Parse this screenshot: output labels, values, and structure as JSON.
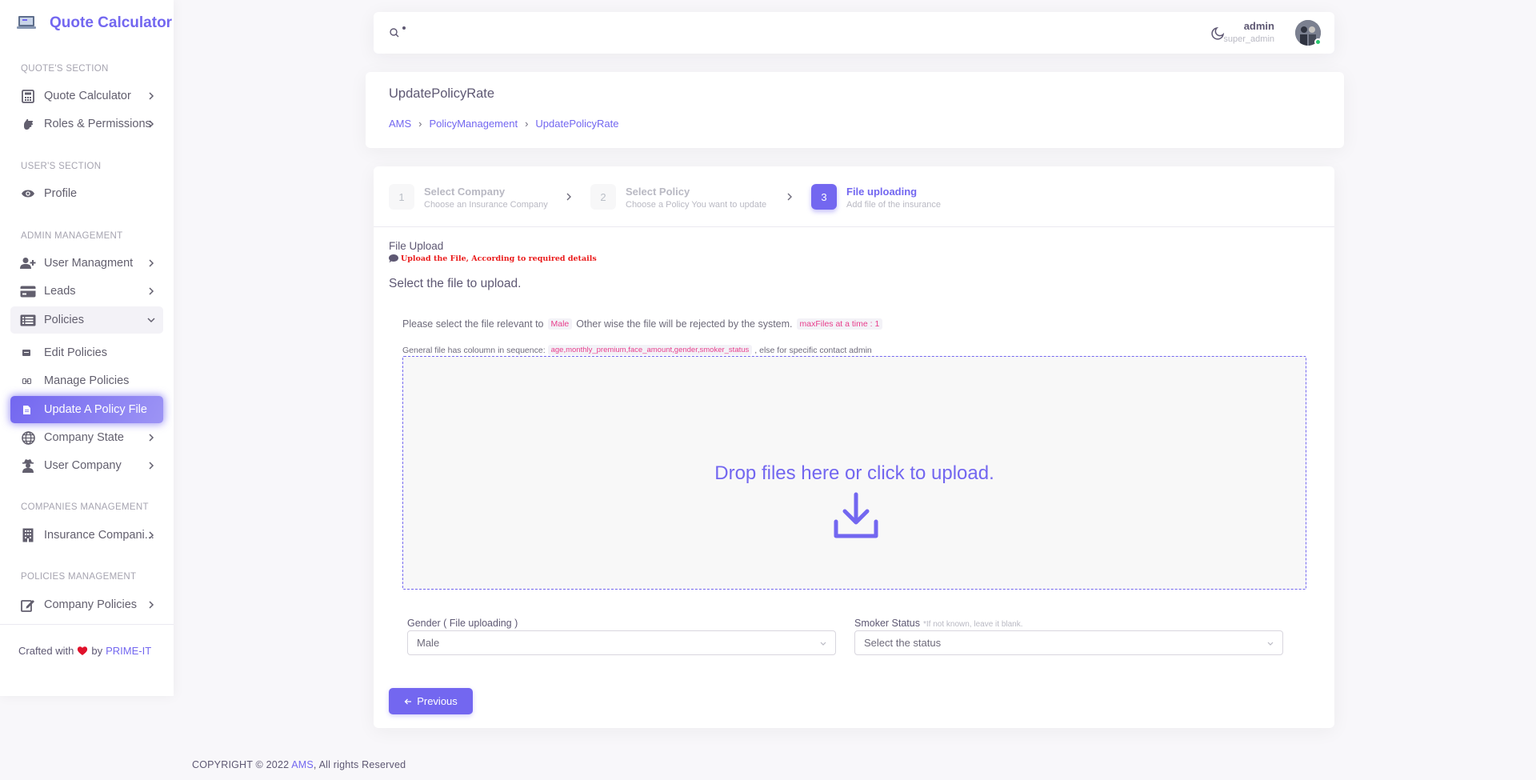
{
  "brand": {
    "name": "Quote Calculator"
  },
  "sidebar": {
    "sections": [
      {
        "header": "QUOTE'S SECTION"
      },
      {
        "header": "USER'S SECTION"
      },
      {
        "header": "ADMIN MANAGEMENT"
      },
      {
        "header": "COMPANIES MANAGEMENT"
      },
      {
        "header": "POLICIES MANAGEMENT"
      }
    ],
    "items": {
      "quote_calculator": "Quote Calculator",
      "roles": "Roles & Permissions",
      "profile": "Profile",
      "user_management": "User Managment",
      "leads": "Leads",
      "policies": "Policies",
      "edit_policies": "Edit Policies",
      "manage_policies": "Manage Policies",
      "update_policy_file": "Update A Policy File",
      "company_state": "Company State",
      "user_company": "User Company",
      "insurance_companies": "Insurance Compani...",
      "company_policies": "Company Policies"
    },
    "footer": {
      "prefix": "Crafted with",
      "by": "by",
      "brand": "PRIME-IT"
    }
  },
  "topbar": {
    "user_name": "admin",
    "user_role": "super_admin"
  },
  "page": {
    "title": "UpdatePolicyRate",
    "breadcrumb": [
      "AMS",
      "PolicyManagement",
      "UpdatePolicyRate"
    ]
  },
  "stepper": {
    "steps": [
      {
        "num": "1",
        "title": "Select Company",
        "subtitle": "Choose an Insurance Company"
      },
      {
        "num": "2",
        "title": "Select Policy",
        "subtitle": "Choose a Policy You want to update"
      },
      {
        "num": "3",
        "title": "File uploading",
        "subtitle": "Add file of the insurance"
      }
    ],
    "active_step": 3
  },
  "upload": {
    "section_label": "File Upload",
    "warning": "Upload the File, According to required details",
    "heading": "Select the file to upload.",
    "info_prefix": "Please select the file relevant to",
    "info_gender": "Male",
    "info_suffix": "Other wise the file will be rejected by the system.",
    "max_files": "maxFiles at a time : 1",
    "columns_prefix": "General file has coloumn in sequence:",
    "columns_code": "age,monthly_premium,face_amount,gender,smoker_status",
    "columns_suffix": ", else for specific contact admin",
    "dropzone_text": "Drop files here or click to upload."
  },
  "form": {
    "gender_label": "Gender ( File uploading )",
    "gender_value": "Male",
    "smoker_label": "Smoker Status",
    "smoker_hint": "*If not known, leave it blank.",
    "smoker_value": "Select the status"
  },
  "actions": {
    "previous": "Previous"
  },
  "footer": {
    "prefix": "COPYRIGHT © 2022",
    "brand": "AMS",
    "suffix": ", All rights Reserved"
  },
  "colors": {
    "primary": "#7367f0",
    "danger": "#ea1c1c",
    "success": "#28c76f"
  },
  "icons": {
    "search": "search-icon",
    "moon": "moon-icon",
    "calculator": "calculator-icon",
    "hand": "hand-icon",
    "eye": "eye-icon",
    "user-plus": "user-plus-icon",
    "card": "credit-card-icon",
    "list": "list-icon",
    "globe": "globe-icon",
    "spy": "user-secret-icon",
    "building": "building-icon",
    "edit": "edit-icon",
    "download": "download-icon"
  }
}
